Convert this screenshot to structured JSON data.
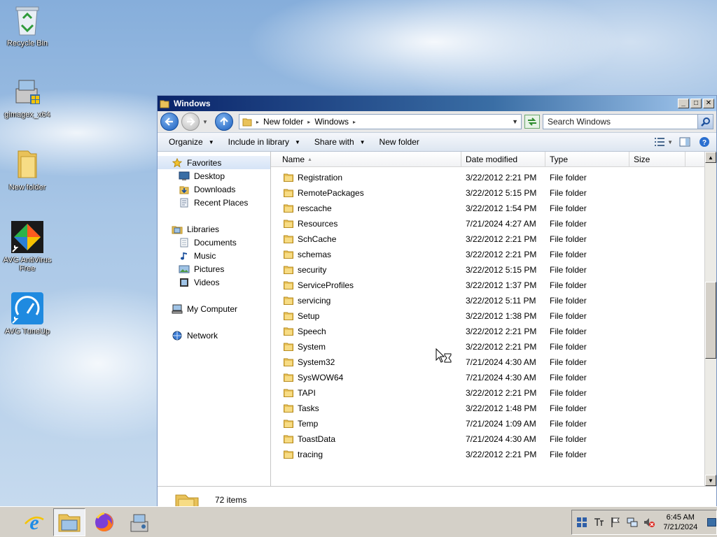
{
  "desktop": {
    "icons": [
      {
        "label": "Recycle Bin"
      },
      {
        "label": "gimagex_x64"
      },
      {
        "label": "New folder"
      },
      {
        "label": "AVG AntiVirus Free"
      },
      {
        "label": "AVG TuneUp"
      }
    ]
  },
  "window": {
    "title": "Windows",
    "address": {
      "crumbs": [
        "New folder",
        "Windows"
      ]
    },
    "search": {
      "placeholder": "Search Windows"
    },
    "commands": {
      "organize": "Organize",
      "include_in_library": "Include in library",
      "share_with": "Share with",
      "new_folder": "New folder"
    },
    "nav": {
      "favorites": "Favorites",
      "desktop": "Desktop",
      "downloads": "Downloads",
      "recent_places": "Recent Places",
      "libraries": "Libraries",
      "documents": "Documents",
      "music": "Music",
      "pictures": "Pictures",
      "videos": "Videos",
      "my_computer": "My Computer",
      "network": "Network"
    },
    "columns": {
      "name": "Name",
      "date_modified": "Date modified",
      "type": "Type",
      "size": "Size"
    },
    "rows": [
      {
        "name": "Registration",
        "date": "3/22/2012 2:21 PM",
        "type": "File folder"
      },
      {
        "name": "RemotePackages",
        "date": "3/22/2012 5:15 PM",
        "type": "File folder"
      },
      {
        "name": "rescache",
        "date": "3/22/2012 1:54 PM",
        "type": "File folder"
      },
      {
        "name": "Resources",
        "date": "7/21/2024 4:27 AM",
        "type": "File folder"
      },
      {
        "name": "SchCache",
        "date": "3/22/2012 2:21 PM",
        "type": "File folder"
      },
      {
        "name": "schemas",
        "date": "3/22/2012 2:21 PM",
        "type": "File folder"
      },
      {
        "name": "security",
        "date": "3/22/2012 5:15 PM",
        "type": "File folder"
      },
      {
        "name": "ServiceProfiles",
        "date": "3/22/2012 1:37 PM",
        "type": "File folder"
      },
      {
        "name": "servicing",
        "date": "3/22/2012 5:11 PM",
        "type": "File folder"
      },
      {
        "name": "Setup",
        "date": "3/22/2012 1:38 PM",
        "type": "File folder"
      },
      {
        "name": "Speech",
        "date": "3/22/2012 2:21 PM",
        "type": "File folder"
      },
      {
        "name": "System",
        "date": "3/22/2012 2:21 PM",
        "type": "File folder"
      },
      {
        "name": "System32",
        "date": "7/21/2024 4:30 AM",
        "type": "File folder"
      },
      {
        "name": "SysWOW64",
        "date": "7/21/2024 4:30 AM",
        "type": "File folder"
      },
      {
        "name": "TAPI",
        "date": "3/22/2012 2:21 PM",
        "type": "File folder"
      },
      {
        "name": "Tasks",
        "date": "3/22/2012 1:48 PM",
        "type": "File folder"
      },
      {
        "name": "Temp",
        "date": "7/21/2024 1:09 AM",
        "type": "File folder"
      },
      {
        "name": "ToastData",
        "date": "7/21/2024 4:30 AM",
        "type": "File folder"
      },
      {
        "name": "tracing",
        "date": "3/22/2012 2:21 PM",
        "type": "File folder"
      }
    ],
    "status": {
      "item_count": "72 items"
    }
  },
  "taskbar": {
    "clock": {
      "time": "6:45 AM",
      "date": "7/21/2024"
    }
  }
}
